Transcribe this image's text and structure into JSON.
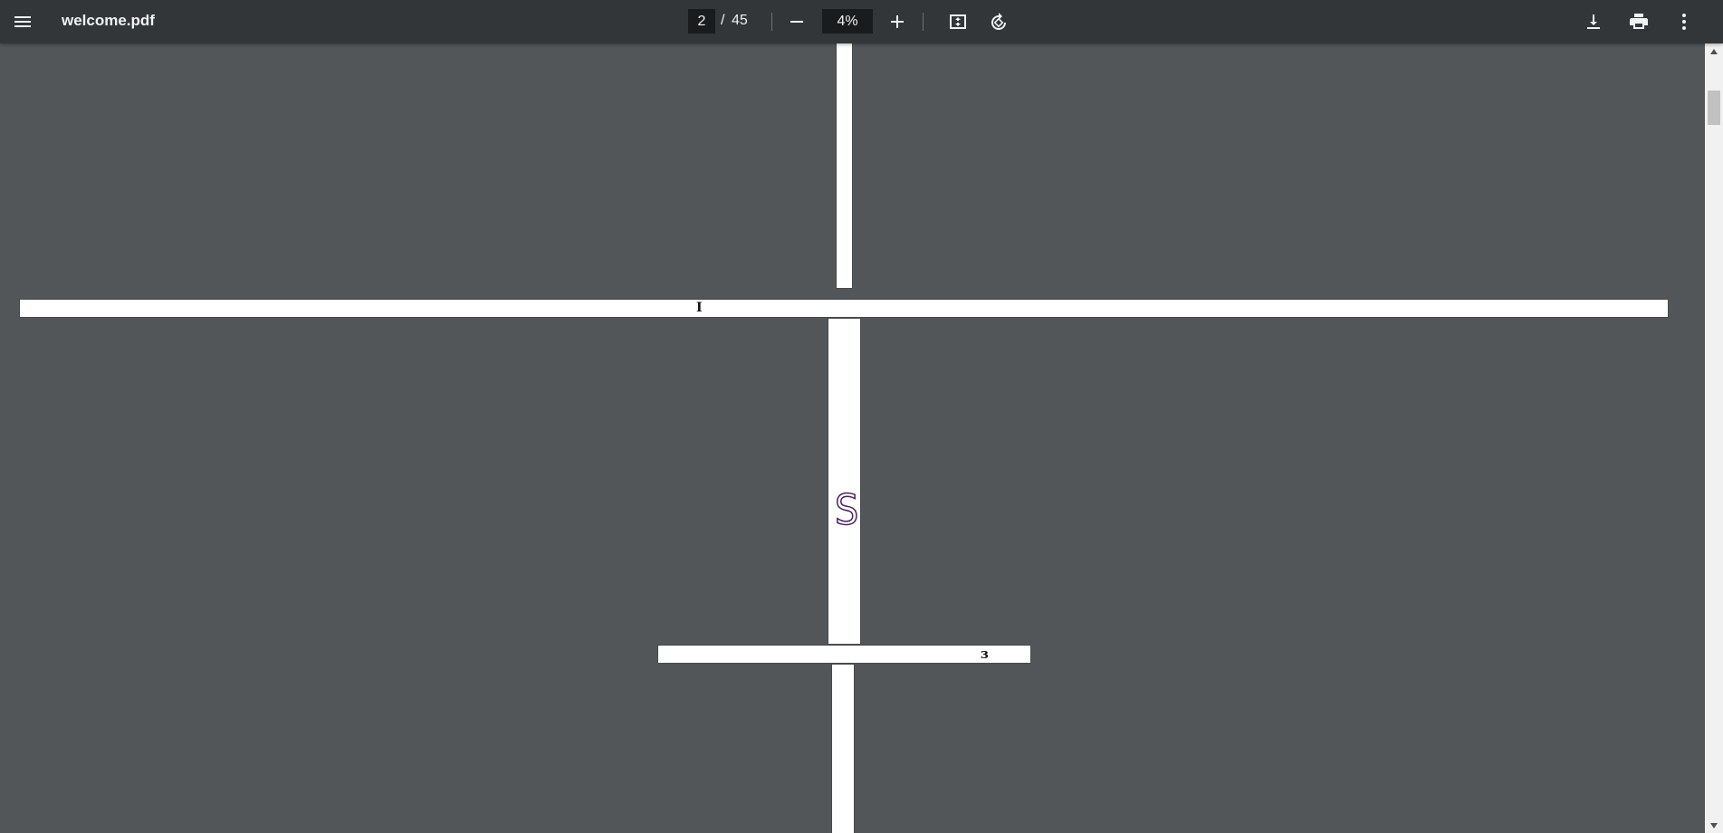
{
  "toolbar": {
    "menu_icon": "hamburger-menu-icon",
    "file_name": "welcome.pdf",
    "current_page": "2",
    "page_separator": "/",
    "total_pages": "45",
    "zoom_out_icon": "minus-icon",
    "zoom_level": "4%",
    "zoom_in_icon": "plus-icon",
    "fit_icon": "fit-to-page-icon",
    "rotate_icon": "rotate-icon",
    "download_icon": "download-icon",
    "print_icon": "print-icon",
    "more_icon": "more-vert-icon"
  },
  "pages": {
    "page_2_glyph": "I",
    "page_3_glyph": "S",
    "page_4_glyph": "ɜ"
  },
  "colors": {
    "toolbar_bg": "#323639",
    "viewer_bg": "#525659",
    "page_bg": "#ffffff",
    "s_glyph_color": "#5a2a6e"
  }
}
